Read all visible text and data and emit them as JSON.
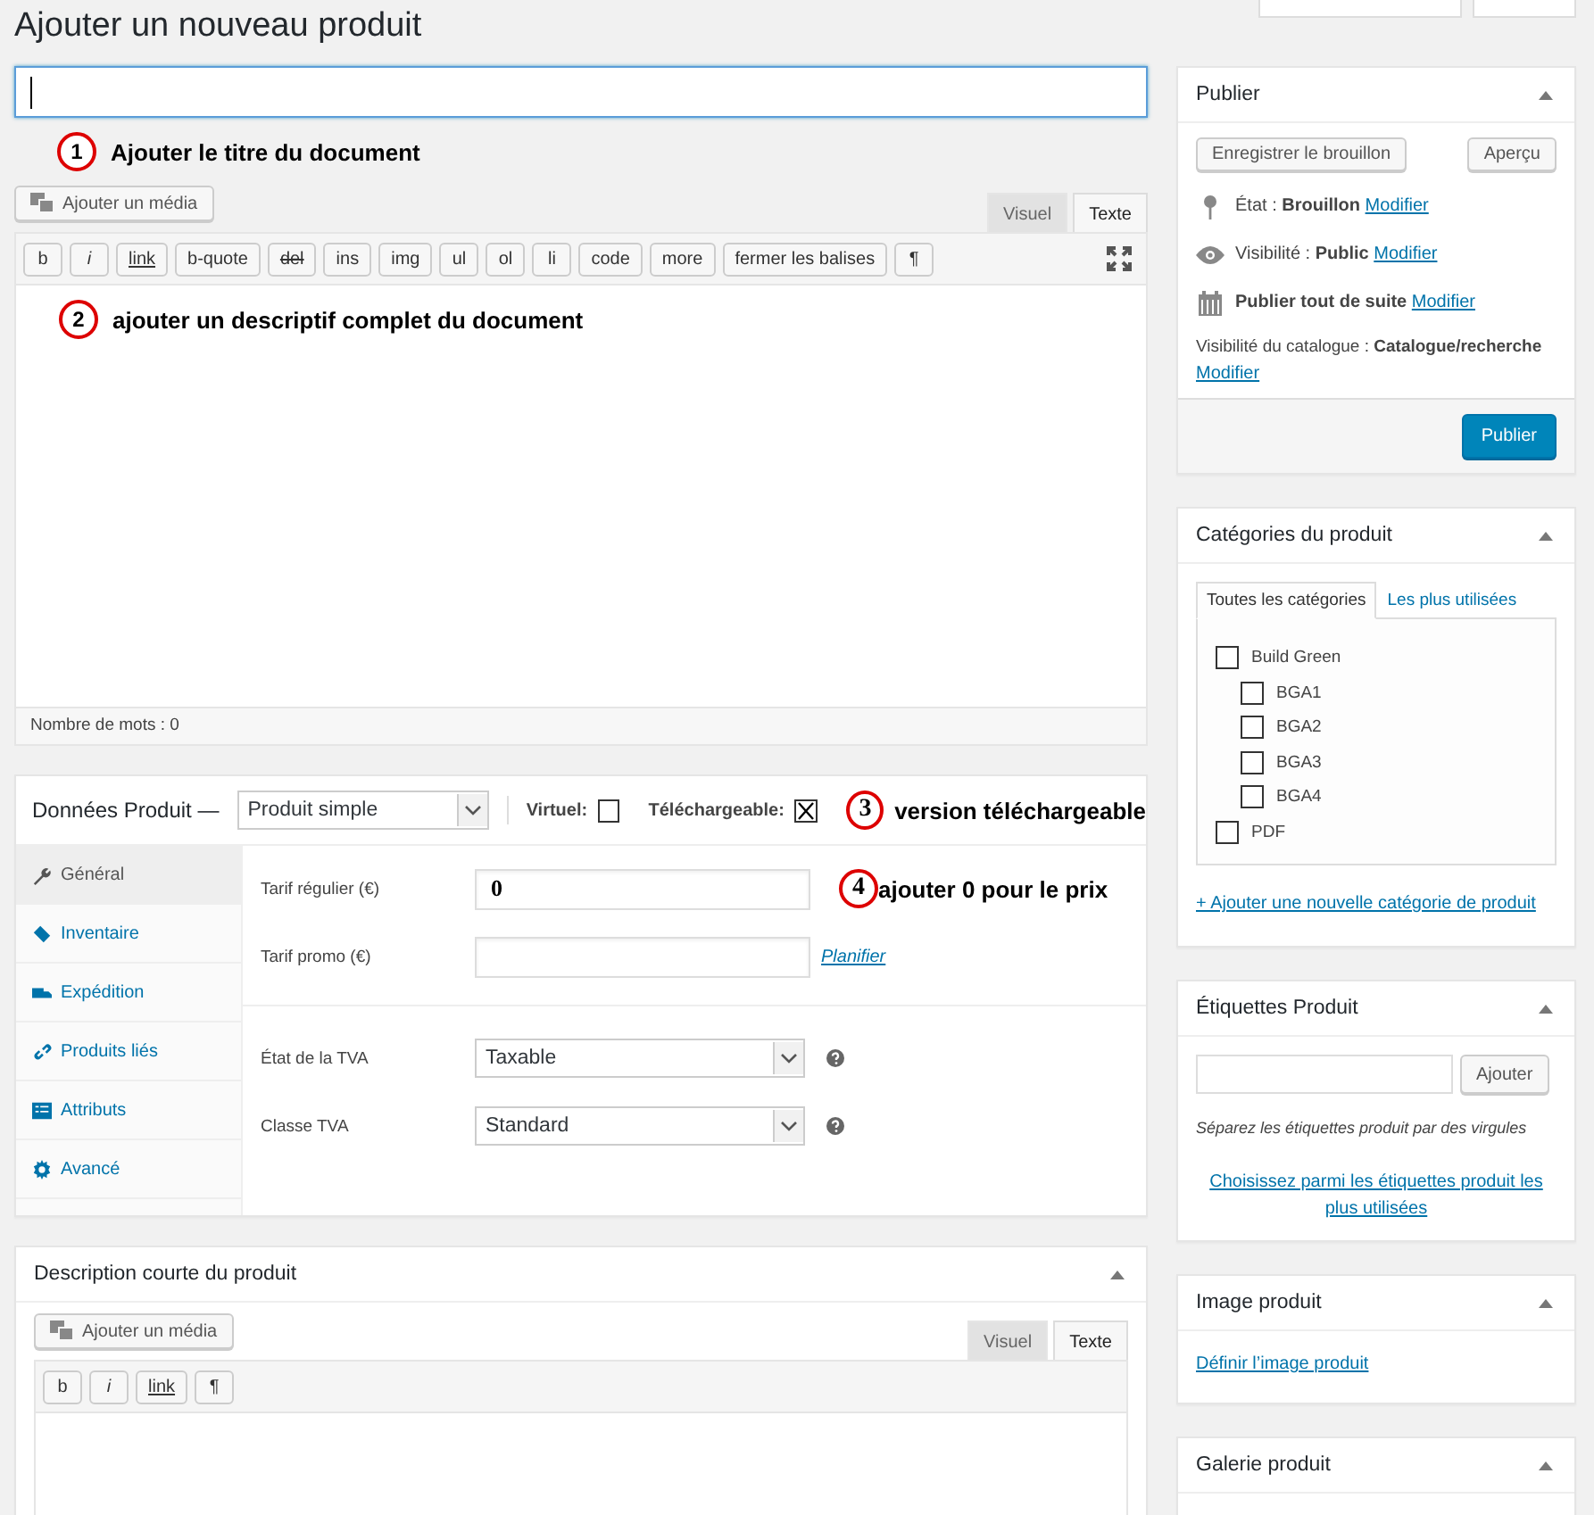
{
  "page_title": "Ajouter un nouveau produit",
  "title_annotation": {
    "number": "1",
    "text": "Ajouter le titre du document"
  },
  "editor": {
    "media_button": "Ajouter un média",
    "tabs": [
      {
        "label": "Visuel",
        "selected": false
      },
      {
        "label": "Texte",
        "selected": true
      }
    ],
    "toolbar": [
      {
        "label": "b",
        "kind": "plain"
      },
      {
        "label": "i",
        "kind": "italic"
      },
      {
        "label": "link",
        "kind": "underline"
      },
      {
        "label": "b-quote",
        "kind": "plain"
      },
      {
        "label": "del",
        "kind": "strike"
      },
      {
        "label": "ins",
        "kind": "plain"
      },
      {
        "label": "img",
        "kind": "plain"
      },
      {
        "label": "ul",
        "kind": "plain"
      },
      {
        "label": "ol",
        "kind": "plain"
      },
      {
        "label": "li",
        "kind": "plain"
      },
      {
        "label": "code",
        "kind": "plain"
      },
      {
        "label": "more",
        "kind": "plain"
      },
      {
        "label": "fermer les balises",
        "kind": "plain"
      },
      {
        "label": "¶",
        "kind": "plain"
      }
    ],
    "annotation": {
      "number": "2",
      "text": "ajouter un descriptif complet du document"
    },
    "word_count": "Nombre de mots : 0"
  },
  "product_data": {
    "title": "Données Produit —",
    "type_select": "Produit simple",
    "virtual": {
      "label": "Virtuel:",
      "checked": false
    },
    "downloadable": {
      "label": "Téléchargeable:",
      "checked": true
    },
    "annotation": {
      "number": "3",
      "text": "version téléchargeable"
    },
    "tabs": [
      {
        "label": "Général",
        "selected": true
      },
      {
        "label": "Inventaire",
        "selected": false
      },
      {
        "label": "Expédition",
        "selected": false
      },
      {
        "label": "Produits liés",
        "selected": false
      },
      {
        "label": "Attributs",
        "selected": false
      },
      {
        "label": "Avancé",
        "selected": false
      }
    ],
    "groups": [
      [
        {
          "label": "Tarif régulier (€)",
          "kind": "text",
          "value": "0",
          "annotation": {
            "number": "4",
            "text": "ajouter 0 pour le prix"
          }
        },
        {
          "label": "Tarif promo (€)",
          "kind": "text",
          "link": "Planifier"
        }
      ],
      [
        {
          "label": "État de la TVA",
          "kind": "select",
          "value": "Taxable"
        },
        {
          "label": "Classe TVA",
          "kind": "select",
          "value": "Standard"
        }
      ]
    ]
  },
  "short_description": {
    "title": "Description courte du produit",
    "media_button": "Ajouter un média",
    "tabs": [
      {
        "label": "Visuel",
        "selected": false
      },
      {
        "label": "Texte",
        "selected": true
      }
    ],
    "toolbar": [
      {
        "label": "b",
        "kind": "plain"
      },
      {
        "label": "i",
        "kind": "italic"
      },
      {
        "label": "link",
        "kind": "underline"
      },
      {
        "label": "¶",
        "kind": "plain"
      }
    ]
  },
  "publish": {
    "title": "Publier",
    "save_draft": "Enregistrer le brouillon",
    "preview": "Aperçu",
    "rows": [
      {
        "text": "État : **Brouillon**",
        "link": "Modifier"
      },
      {
        "text": "Visibilité : **Public**",
        "link": "Modifier"
      },
      {
        "text": "**Publier tout de suite**",
        "link": "Modifier"
      }
    ],
    "catalog": "Visibilité du catalogue : **Catalogue/recherche**",
    "catalog_link": "Modifier",
    "button": "Publier"
  },
  "categories": {
    "title": "Catégories du produit",
    "tabs": [
      {
        "label": "Toutes les catégories",
        "selected": true
      },
      {
        "label": "Les plus utilisées",
        "selected": false
      }
    ],
    "items": [
      {
        "label": "Build Green",
        "checked": false,
        "children": [
          {
            "label": "BGA1",
            "checked": false
          },
          {
            "label": "BGA2",
            "checked": false
          },
          {
            "label": "BGA3",
            "checked": false
          },
          {
            "label": "BGA4",
            "checked": false
          }
        ]
      },
      {
        "label": "PDF",
        "checked": false
      }
    ],
    "add_link": "+ Ajouter une nouvelle catégorie de produit"
  },
  "tags": {
    "title": "Étiquettes Produit",
    "button": "Ajouter",
    "hint": "Séparez les étiquettes produit par des virgules",
    "link": "Choisissez parmi les étiquettes produit les plus utilisées"
  },
  "image": {
    "title": "Image produit",
    "link": "Définir l’image produit"
  },
  "gallery": {
    "title": "Galerie produit"
  }
}
